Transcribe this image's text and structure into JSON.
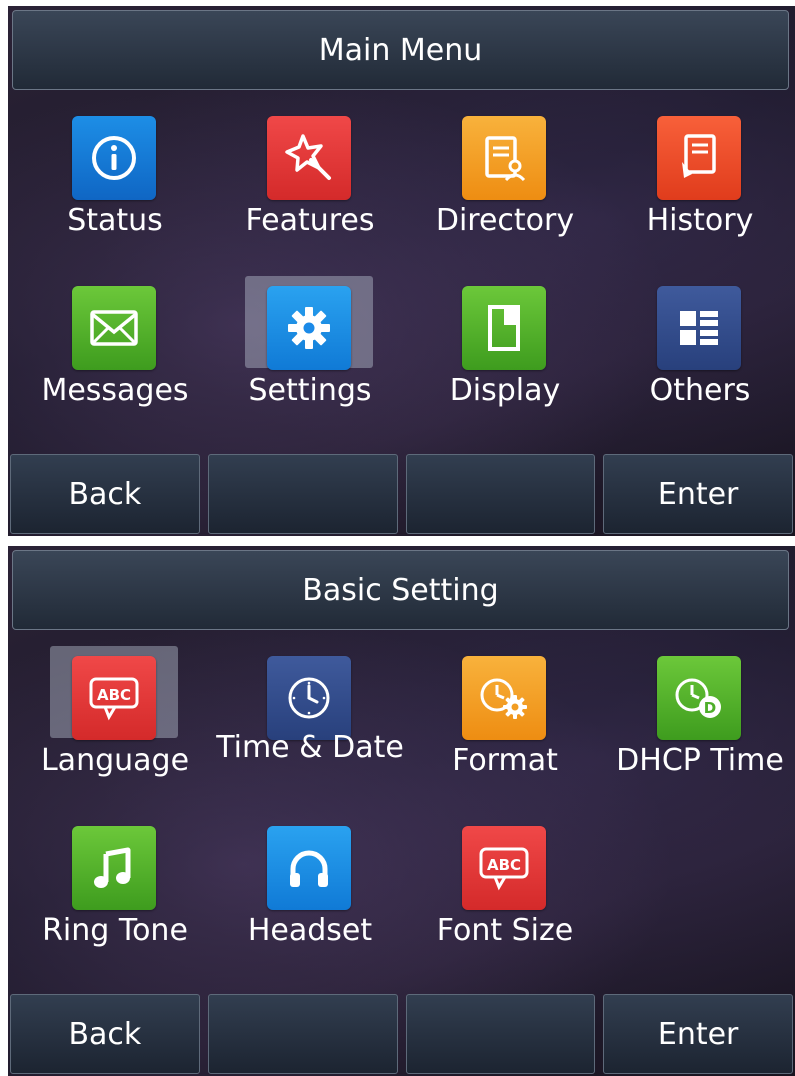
{
  "screens": [
    {
      "title": "Main Menu",
      "items": [
        {
          "label": "Status",
          "icon": "info-icon",
          "color": "#1473d0"
        },
        {
          "label": "Features",
          "icon": "magic-star-icon",
          "color": "#e33a3a"
        },
        {
          "label": "Directory",
          "icon": "directory-book-icon",
          "color": "#f29d22"
        },
        {
          "label": "History",
          "icon": "history-icon",
          "color": "#ec4a28"
        },
        {
          "label": "Messages",
          "icon": "envelope-icon",
          "color": "#4eae2a"
        },
        {
          "label": "Settings",
          "icon": "gear-icon",
          "color": "#1b8ae8",
          "selected": true
        },
        {
          "label": "Display",
          "icon": "display-icon",
          "color": "#4eae2a"
        },
        {
          "label": "Others",
          "icon": "grid-list-icon",
          "color": "#2f4c8c"
        }
      ],
      "softkeys": [
        "Back",
        "",
        "",
        "Enter"
      ]
    },
    {
      "title": "Basic Setting",
      "items": [
        {
          "label": "Language",
          "icon": "abc-speech-icon",
          "color": "#e33a3a",
          "selected": true
        },
        {
          "label": "Time & Date",
          "icon": "clock-icon",
          "color": "#2f4c8c"
        },
        {
          "label": "Format",
          "icon": "clock-gear-icon",
          "color": "#f29d22"
        },
        {
          "label": "DHCP Time",
          "icon": "clock-dhcp-icon",
          "color": "#4eae2a"
        },
        {
          "label": "Ring Tone",
          "icon": "music-note-icon",
          "color": "#4eae2a"
        },
        {
          "label": "Headset",
          "icon": "headset-icon",
          "color": "#1b8ae8"
        },
        {
          "label": "Font Size",
          "icon": "abc-speech-icon",
          "color": "#e33a3a"
        }
      ],
      "softkeys": [
        "Back",
        "",
        "",
        "Enter"
      ]
    }
  ]
}
